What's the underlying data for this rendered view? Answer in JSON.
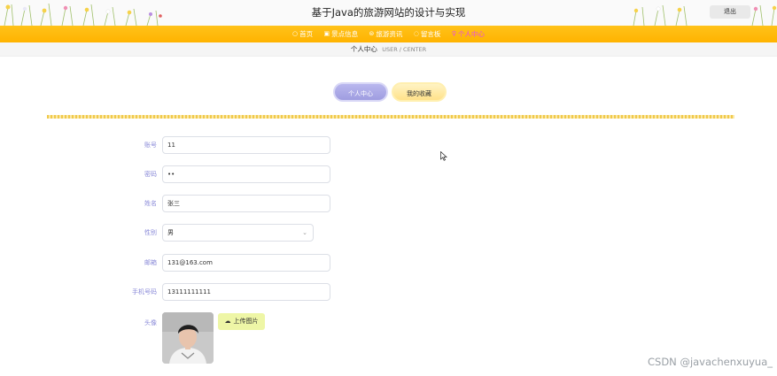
{
  "header": {
    "title": "基于Java的旅游网站的设计与实现",
    "logout_label": "退出"
  },
  "nav": {
    "items": [
      {
        "label": "首页",
        "icon": "home-icon",
        "glyph": "○"
      },
      {
        "label": "景点信息",
        "icon": "list-icon",
        "glyph": "▣"
      },
      {
        "label": "旅游资讯",
        "icon": "news-icon",
        "glyph": "⊜"
      },
      {
        "label": "留言板",
        "icon": "message-icon",
        "glyph": "◌"
      },
      {
        "label": "个人中心",
        "icon": "user-icon",
        "glyph": "♀"
      }
    ],
    "active_index": 4
  },
  "breadcrumb": {
    "main": "个人中心",
    "sub": "USER / CENTER"
  },
  "tabs": {
    "profile": "个人中心",
    "favorites": "我的收藏"
  },
  "form": {
    "account_label": "账号",
    "account_value": "11",
    "password_label": "密码",
    "password_value": "••",
    "name_label": "姓名",
    "name_value": "张三",
    "gender_label": "性别",
    "gender_value": "男",
    "email_label": "邮箱",
    "email_value": "131@163.com",
    "phone_label": "手机号码",
    "phone_value": "13111111111",
    "avatar_label": "头像",
    "upload_label": "上传图片"
  },
  "watermark": "CSDN @javachenxuyua_",
  "colors": {
    "nav_bg": "#ffb300",
    "active_nav": "#e64be6",
    "label": "#8a8ad8",
    "upload_bg": "#eef6a6"
  }
}
